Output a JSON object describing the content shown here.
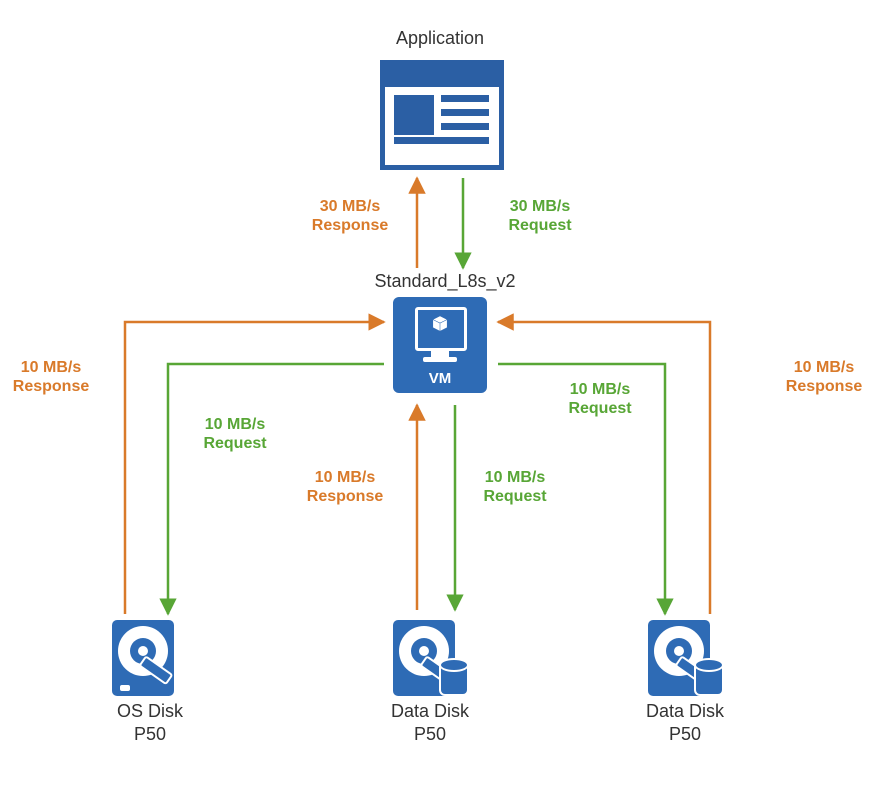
{
  "nodes": {
    "application": {
      "title": "Application"
    },
    "vm": {
      "title": "Standard_L8s_v2",
      "label": "VM"
    },
    "os_disk": {
      "name": "OS Disk",
      "tier": "P50"
    },
    "data_disk_1": {
      "name": "Data Disk",
      "tier": "P50"
    },
    "data_disk_2": {
      "name": "Data Disk",
      "tier": "P50"
    }
  },
  "flows": {
    "app_vm_response": {
      "rate": "30 MB/s",
      "kind": "Response"
    },
    "app_vm_request": {
      "rate": "30 MB/s",
      "kind": "Request"
    },
    "vm_os_request": {
      "rate": "10 MB/s",
      "kind": "Request"
    },
    "vm_os_response": {
      "rate": "10 MB/s",
      "kind": "Response"
    },
    "vm_d1_request": {
      "rate": "10 MB/s",
      "kind": "Request"
    },
    "vm_d1_response": {
      "rate": "10 MB/s",
      "kind": "Response"
    },
    "vm_d2_request": {
      "rate": "10 MB/s",
      "kind": "Request"
    },
    "vm_d2_response": {
      "rate": "10 MB/s",
      "kind": "Response"
    }
  },
  "colors": {
    "node": "#2e6bb5",
    "request": "#58a636",
    "response": "#d97a2a"
  }
}
